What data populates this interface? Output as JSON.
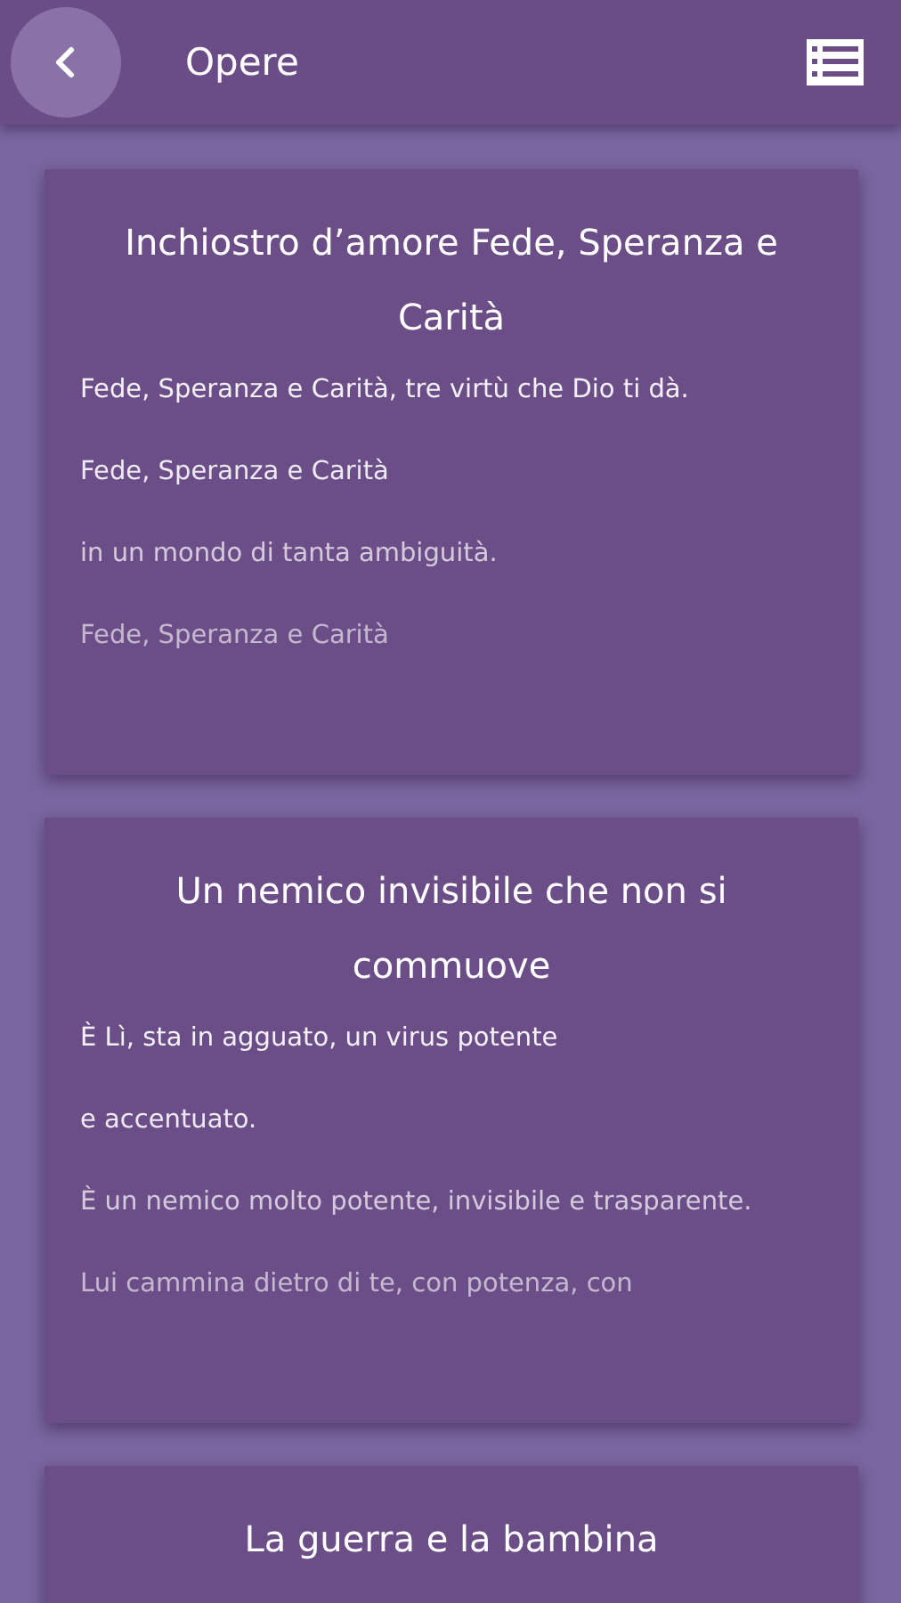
{
  "header": {
    "title": "Opere"
  },
  "cards": [
    {
      "title": "Inchiostro d’amore Fede, Speranza e Carità",
      "lines": [
        "Fede, Speranza e Carità, tre virtù che Dio ti dà.",
        "Fede, Speranza e Carità",
        "in un mondo di tanta ambiguità.",
        "Fede, Speranza e Carità"
      ]
    },
    {
      "title": "Un nemico invisibile che non si commuove",
      "lines": [
        "È Lì, sta in agguato, un virus potente",
        "e accentuato.",
        "È un nemico molto potente, invisibile e trasparente.",
        "Lui cammina dietro di te, con potenza, con"
      ]
    },
    {
      "title": "La guerra e la bambina"
    }
  ]
}
